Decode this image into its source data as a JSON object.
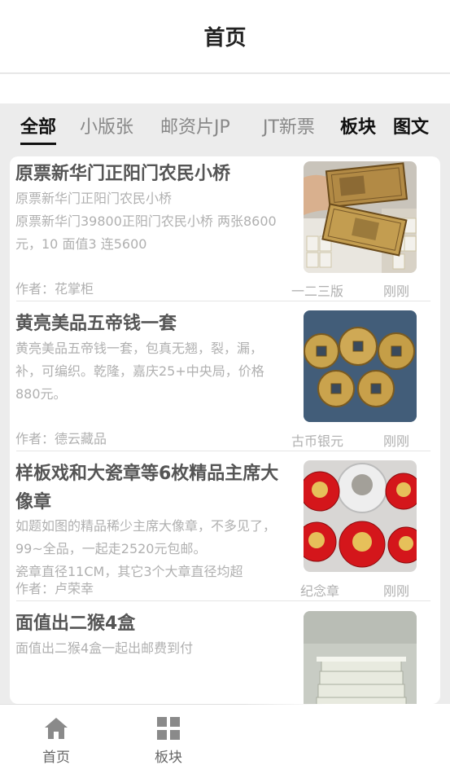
{
  "header": {
    "title": "首页"
  },
  "tabs": [
    {
      "label": "全部"
    },
    {
      "label": "小版张"
    },
    {
      "label": "邮资片JP"
    },
    {
      "label": "JT新票"
    },
    {
      "label": "板块"
    },
    {
      "label": "图文"
    }
  ],
  "items": [
    {
      "title": "原票新华门正阳门农民小桥",
      "desc": "原票新华门正阳门农民小桥\n原票新华门39800正阳门农民小桥 两张8600 元，10 面值3 连5600",
      "author": "作者：花掌柜",
      "category": "一二三版",
      "time": "刚刚",
      "image": "banknote-photo"
    },
    {
      "title": "黄亮美品五帝钱一套",
      "desc": "黄亮美品五帝钱一套，包真无翘，裂，漏，补，可编织。乾隆，嘉庆25+中央局，价格880元。",
      "author": "作者：德云藏品",
      "category": "古币银元",
      "time": "刚刚",
      "image": "coins-photo"
    },
    {
      "title": "样板戏和大瓷章等6枚精品主席大像章",
      "desc": "如题如图的精品稀少主席大像章，不多见了，99~全品，一起走2520元包邮。\n瓷章直径11CM，其它3个大章直径均超",
      "author": "作者：卢荣幸",
      "category": "纪念章",
      "time": "刚刚",
      "image": "badges-photo"
    },
    {
      "title": "面值出二猴4盒",
      "desc": "面值出二猴4盒一起出邮费到付",
      "author": "",
      "category": "",
      "time": "",
      "image": "stamp-boxes-photo"
    }
  ],
  "bottom_nav": [
    {
      "label": "首页",
      "icon": "home-icon"
    },
    {
      "label": "板块",
      "icon": "grid-icon"
    }
  ]
}
